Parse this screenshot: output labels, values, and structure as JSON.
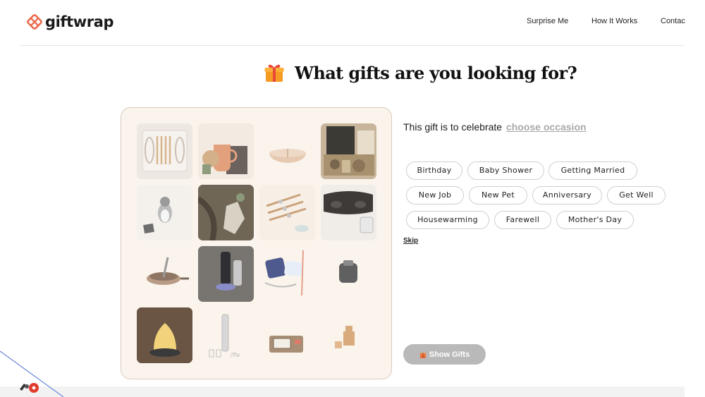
{
  "brand": {
    "name": "giftwrap",
    "accent": "#e96a4a"
  },
  "nav": {
    "surprise": "Surprise Me",
    "how": "How It Works",
    "contact": "Contac"
  },
  "title": "What gifts are you looking for?",
  "prompt": {
    "text": "This gift is to celebrate",
    "link": "choose occasion"
  },
  "occasions": [
    "Birthday",
    "Baby Shower",
    "Getting Married",
    "New Job",
    "New Pet",
    "Anniversary",
    "Get Well",
    "Housewarming",
    "Farewell",
    "Mother's Day"
  ],
  "skip": "Skip",
  "show_gifts": "Show Gifts",
  "icons": {
    "logo": "giftwrap-logo-icon",
    "title": "gift-box-icon",
    "button": "gift-icon",
    "widget": "extension-widget-icon"
  }
}
